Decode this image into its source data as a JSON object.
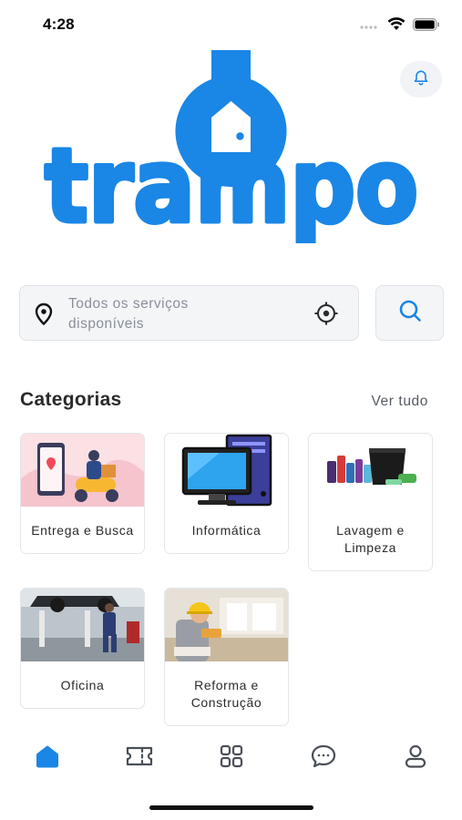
{
  "status_bar": {
    "time": "4:28"
  },
  "logo": {
    "wordmark": "trampo"
  },
  "search": {
    "placeholder": "Todos os serviços disponíveis"
  },
  "categories": {
    "title": "Categorias",
    "see_all": "Ver tudo",
    "items": [
      {
        "label": "Entrega e Busca"
      },
      {
        "label": "Informática"
      },
      {
        "label": "Lavagem e Limpeza"
      },
      {
        "label": "Oficina"
      },
      {
        "label": "Reforma e Construção"
      }
    ]
  },
  "bottom_nav": [
    {
      "icon": "home-icon",
      "active": true
    },
    {
      "icon": "ticket-icon",
      "active": false
    },
    {
      "icon": "grid-icon",
      "active": false
    },
    {
      "icon": "chat-icon",
      "active": false
    },
    {
      "icon": "user-icon",
      "active": false
    }
  ],
  "colors": {
    "brand": "#1a86e6",
    "nav_inactive": "#4a4f57"
  }
}
